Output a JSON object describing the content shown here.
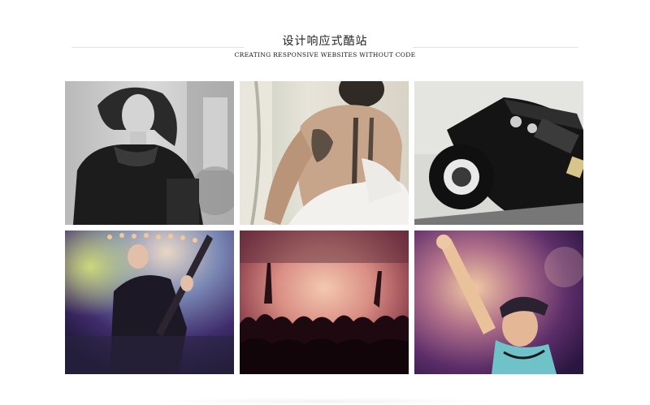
{
  "header": {
    "title": "设计响应式酷站",
    "subtitle": "CREATING RESPONSIVE WEBSITES WITHOUT CODE"
  },
  "gallery": {
    "items": [
      {
        "id": "woman-portrait",
        "tone": "grayscale"
      },
      {
        "id": "tattooed-back",
        "tone": "warm-light"
      },
      {
        "id": "classic-car",
        "tone": "dark"
      },
      {
        "id": "guitarist-concert",
        "tone": "blue-purple"
      },
      {
        "id": "crowd-concert",
        "tone": "red-warm"
      },
      {
        "id": "raised-hand-fan",
        "tone": "purple-teal"
      }
    ]
  }
}
